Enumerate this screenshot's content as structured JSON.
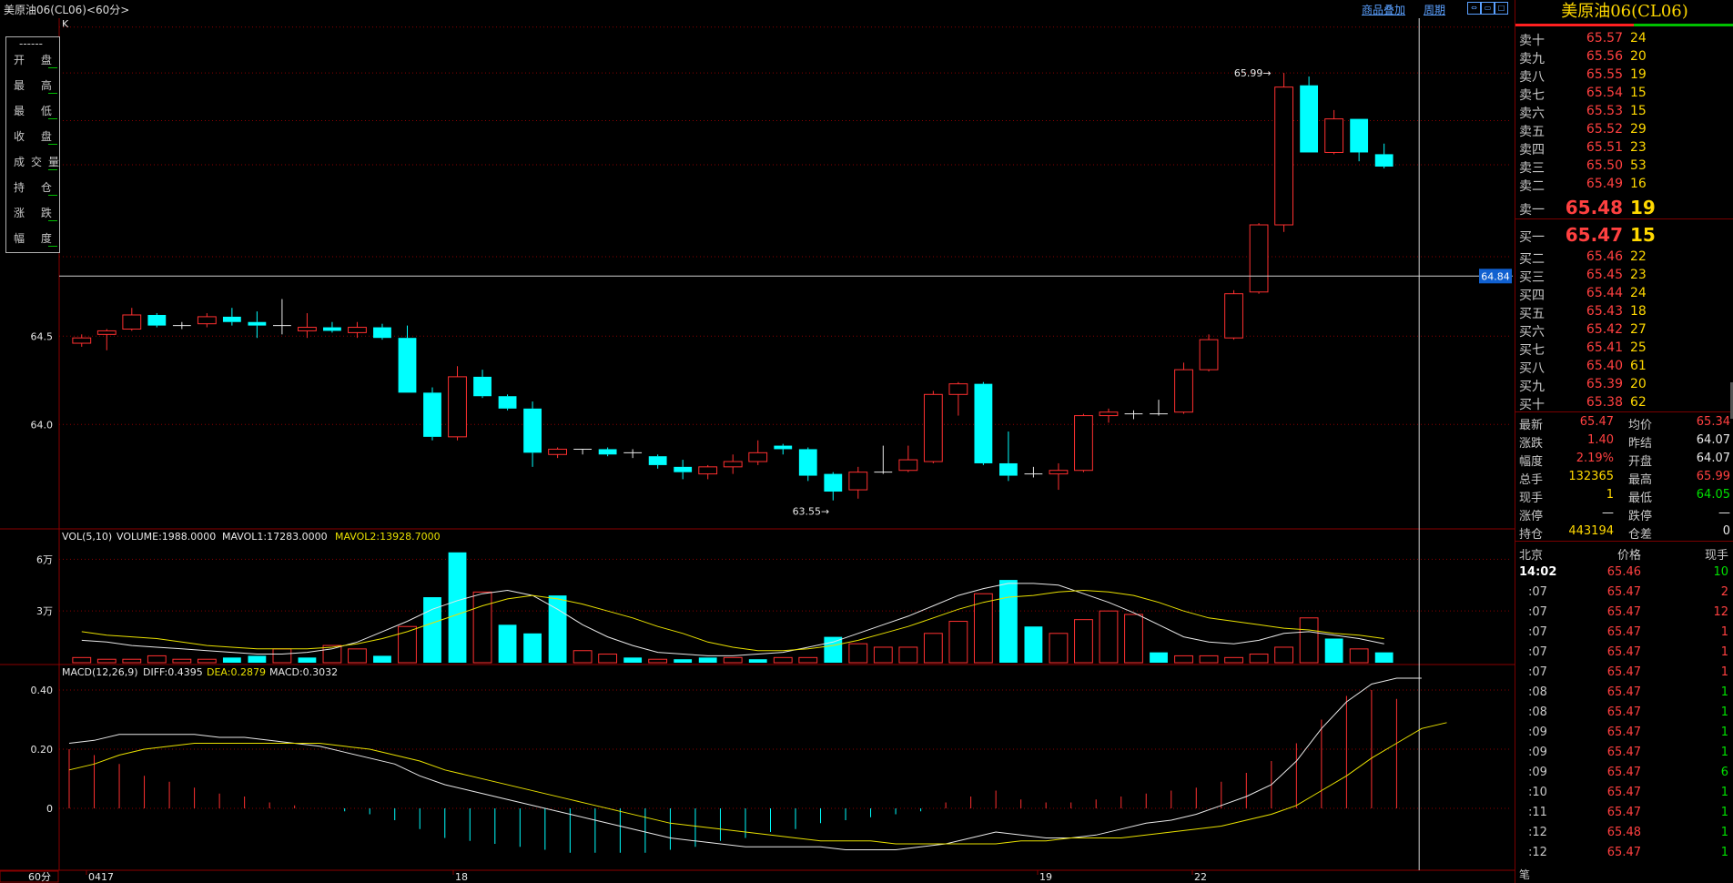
{
  "window": {
    "title": "美原油06(CL06)<60分>",
    "links": [
      "商品叠加",
      "周期"
    ],
    "window_buttons": [
      "restore-icon",
      "minimize-icon",
      "maximize-icon",
      "close-icon"
    ]
  },
  "kchart": {
    "type": "candlestick",
    "label": "K",
    "y_ticks": [
      "64.5",
      "64.0"
    ],
    "crosshair_price": "64.84",
    "high_label": "65.99→",
    "low_label": "63.55→",
    "candles": [
      [
        64.46,
        64.51,
        64.44,
        64.49
      ],
      [
        64.51,
        64.54,
        64.42,
        64.53
      ],
      [
        64.54,
        64.66,
        64.53,
        64.62
      ],
      [
        64.62,
        64.63,
        64.55,
        64.56
      ],
      [
        64.56,
        64.58,
        64.54,
        64.55
      ],
      [
        64.57,
        64.63,
        64.55,
        64.61
      ],
      [
        64.61,
        64.66,
        64.56,
        64.58
      ],
      [
        64.58,
        64.64,
        64.49,
        64.56
      ],
      [
        64.56,
        64.71,
        64.51,
        64.55
      ],
      [
        64.53,
        64.63,
        64.49,
        64.55
      ],
      [
        64.55,
        64.58,
        64.52,
        64.53
      ],
      [
        64.52,
        64.58,
        64.49,
        64.55
      ],
      [
        64.55,
        64.57,
        64.48,
        64.49
      ],
      [
        64.49,
        64.56,
        64.18,
        64.18
      ],
      [
        64.18,
        64.21,
        63.91,
        63.93
      ],
      [
        63.93,
        64.33,
        63.91,
        64.27
      ],
      [
        64.27,
        64.31,
        64.15,
        64.16
      ],
      [
        64.16,
        64.17,
        64.08,
        64.09
      ],
      [
        64.09,
        64.13,
        63.76,
        63.84
      ],
      [
        63.83,
        63.87,
        63.81,
        63.86
      ],
      [
        63.86,
        63.86,
        63.83,
        63.85
      ],
      [
        63.86,
        63.87,
        63.82,
        63.83
      ],
      [
        63.84,
        63.86,
        63.81,
        63.83
      ],
      [
        63.82,
        63.83,
        63.75,
        63.77
      ],
      [
        63.76,
        63.8,
        63.69,
        63.73
      ],
      [
        63.72,
        63.77,
        63.69,
        63.76
      ],
      [
        63.76,
        63.83,
        63.72,
        63.79
      ],
      [
        63.79,
        63.91,
        63.77,
        63.84
      ],
      [
        63.88,
        63.89,
        63.83,
        63.86
      ],
      [
        63.86,
        63.87,
        63.68,
        63.71
      ],
      [
        63.72,
        63.73,
        63.57,
        63.62
      ],
      [
        63.63,
        63.76,
        63.58,
        63.73
      ],
      [
        63.73,
        63.88,
        63.72,
        63.74
      ],
      [
        63.74,
        63.88,
        63.73,
        63.8
      ],
      [
        63.79,
        64.19,
        63.78,
        64.17
      ],
      [
        64.17,
        64.24,
        64.05,
        64.23
      ],
      [
        64.23,
        64.24,
        63.77,
        63.78
      ],
      [
        63.78,
        63.96,
        63.68,
        63.71
      ],
      [
        63.72,
        63.76,
        63.7,
        63.73
      ],
      [
        63.72,
        63.78,
        63.63,
        63.74
      ],
      [
        63.74,
        64.06,
        63.73,
        64.05
      ],
      [
        64.05,
        64.09,
        64.01,
        64.07
      ],
      [
        64.06,
        64.08,
        64.03,
        64.06
      ],
      [
        64.06,
        64.14,
        64.05,
        64.06
      ],
      [
        64.07,
        64.35,
        64.06,
        64.31
      ],
      [
        64.31,
        64.51,
        64.3,
        64.48
      ],
      [
        64.49,
        64.76,
        64.48,
        64.74
      ],
      [
        64.75,
        65.14,
        64.74,
        65.13
      ],
      [
        65.13,
        65.99,
        65.09,
        65.91
      ],
      [
        65.92,
        65.97,
        65.54,
        65.54
      ],
      [
        65.54,
        65.78,
        65.53,
        65.73
      ],
      [
        65.73,
        65.73,
        65.49,
        65.54
      ],
      [
        65.53,
        65.59,
        65.45,
        65.46
      ]
    ]
  },
  "volume": {
    "header_name": "VOL(5,10)",
    "header_volume": "VOLUME:1988.0000",
    "header_mavol1": "MAVOL1:17283.0000",
    "header_mavol2": "MAVOL2:13928.7000",
    "y_ticks": [
      "6万",
      "3万"
    ],
    "values": [
      3,
      2,
      2,
      4,
      2,
      2,
      3,
      4,
      8,
      3,
      10,
      8,
      4,
      21,
      38,
      64,
      41,
      22,
      17,
      39,
      7,
      5,
      3,
      2,
      2,
      3,
      3,
      2,
      3,
      3,
      15,
      11,
      9,
      9,
      17,
      24,
      40,
      48,
      21,
      17,
      25,
      30,
      28,
      6,
      4,
      4,
      3,
      5,
      9,
      26,
      14,
      8,
      6,
      2
    ],
    "up": [
      1,
      1,
      1,
      1,
      1,
      1,
      0,
      0,
      1,
      0,
      1,
      1,
      0,
      1,
      0,
      0,
      1,
      0,
      0,
      0,
      1,
      1,
      0,
      1,
      0,
      0,
      1,
      0,
      1,
      1,
      0,
      1,
      1,
      1,
      1,
      1,
      1,
      0,
      0,
      1,
      1,
      1,
      1,
      0,
      1,
      1,
      1,
      1,
      1,
      1,
      0,
      1,
      0,
      0
    ],
    "ma1": [
      13,
      12,
      10,
      9,
      8,
      7,
      6,
      5,
      5,
      6,
      8,
      12,
      18,
      24,
      31,
      36,
      40,
      42,
      39,
      31,
      22,
      15,
      10,
      6,
      5,
      4,
      4,
      5,
      6,
      9,
      12,
      17,
      22,
      27,
      33,
      39,
      43,
      46,
      46,
      45,
      40,
      35,
      29,
      22,
      15,
      12,
      11,
      13,
      17,
      18,
      16,
      14,
      11
    ],
    "ma2": [
      18,
      16,
      15,
      14,
      12,
      10,
      9,
      8,
      8,
      8,
      9,
      11,
      14,
      18,
      23,
      28,
      33,
      37,
      39,
      37,
      34,
      30,
      26,
      21,
      17,
      12,
      9,
      7,
      7,
      8,
      10,
      13,
      17,
      21,
      26,
      31,
      35,
      38,
      39,
      41,
      42,
      41,
      39,
      35,
      30,
      26,
      24,
      22,
      20,
      19,
      17,
      16,
      14
    ]
  },
  "macd": {
    "header_name": "MACD(12,26,9)",
    "header_diff": "DIFF:0.4395",
    "header_dea": "DEA:0.2879",
    "header_macd": "MACD:0.3032",
    "y_ticks": [
      "0.40",
      "0.20",
      "0"
    ],
    "diff": [
      0.22,
      0.23,
      0.25,
      0.25,
      0.25,
      0.25,
      0.24,
      0.24,
      0.23,
      0.22,
      0.21,
      0.19,
      0.17,
      0.15,
      0.11,
      0.08,
      0.06,
      0.04,
      0.02,
      0.0,
      -0.02,
      -0.04,
      -0.06,
      -0.08,
      -0.1,
      -0.11,
      -0.12,
      -0.13,
      -0.13,
      -0.13,
      -0.13,
      -0.14,
      -0.14,
      -0.14,
      -0.13,
      -0.12,
      -0.1,
      -0.08,
      -0.09,
      -0.1,
      -0.1,
      -0.09,
      -0.07,
      -0.05,
      -0.04,
      -0.02,
      0.01,
      0.04,
      0.08,
      0.16,
      0.27,
      0.36,
      0.42,
      0.44,
      0.44
    ],
    "dea": [
      0.13,
      0.15,
      0.18,
      0.2,
      0.21,
      0.22,
      0.22,
      0.22,
      0.22,
      0.22,
      0.22,
      0.21,
      0.2,
      0.18,
      0.16,
      0.13,
      0.11,
      0.09,
      0.07,
      0.05,
      0.03,
      0.01,
      -0.01,
      -0.03,
      -0.05,
      -0.06,
      -0.07,
      -0.08,
      -0.09,
      -0.1,
      -0.11,
      -0.11,
      -0.11,
      -0.12,
      -0.12,
      -0.12,
      -0.12,
      -0.12,
      -0.11,
      -0.11,
      -0.1,
      -0.1,
      -0.1,
      -0.09,
      -0.08,
      -0.07,
      -0.06,
      -0.04,
      -0.02,
      0.01,
      0.06,
      0.11,
      0.17,
      0.22,
      0.27,
      0.29
    ],
    "macd": [
      0.2,
      0.18,
      0.15,
      0.11,
      0.09,
      0.07,
      0.05,
      0.04,
      0.02,
      0.01,
      0.0,
      -0.01,
      -0.02,
      -0.04,
      -0.07,
      -0.1,
      -0.11,
      -0.12,
      -0.13,
      -0.14,
      -0.15,
      -0.15,
      -0.15,
      -0.15,
      -0.14,
      -0.13,
      -0.11,
      -0.1,
      -0.08,
      -0.07,
      -0.05,
      -0.04,
      -0.03,
      -0.02,
      -0.01,
      0.02,
      0.04,
      0.06,
      0.03,
      0.02,
      0.02,
      0.03,
      0.04,
      0.05,
      0.06,
      0.07,
      0.09,
      0.12,
      0.16,
      0.22,
      0.3,
      0.38,
      0.4,
      0.37,
      0.3
    ]
  },
  "xaxis": {
    "period": "60分",
    "labels": [
      "0417",
      "18",
      "19",
      "22"
    ]
  },
  "quote": {
    "title": "美原油06(CL06)",
    "sell": [
      {
        "label": "卖十",
        "price": "65.57",
        "vol": "24"
      },
      {
        "label": "卖九",
        "price": "65.56",
        "vol": "20"
      },
      {
        "label": "卖八",
        "price": "65.55",
        "vol": "19"
      },
      {
        "label": "卖七",
        "price": "65.54",
        "vol": "15"
      },
      {
        "label": "卖六",
        "price": "65.53",
        "vol": "15"
      },
      {
        "label": "卖五",
        "price": "65.52",
        "vol": "29"
      },
      {
        "label": "卖四",
        "price": "65.51",
        "vol": "23"
      },
      {
        "label": "卖三",
        "price": "65.50",
        "vol": "53"
      },
      {
        "label": "卖二",
        "price": "65.49",
        "vol": "16"
      },
      {
        "label": "卖一",
        "price": "65.48",
        "vol": "19"
      }
    ],
    "buy": [
      {
        "label": "买一",
        "price": "65.47",
        "vol": "15"
      },
      {
        "label": "买二",
        "price": "65.46",
        "vol": "22"
      },
      {
        "label": "买三",
        "price": "65.45",
        "vol": "23"
      },
      {
        "label": "买四",
        "price": "65.44",
        "vol": "24"
      },
      {
        "label": "买五",
        "price": "65.43",
        "vol": "18"
      },
      {
        "label": "买六",
        "price": "65.42",
        "vol": "27"
      },
      {
        "label": "买七",
        "price": "65.41",
        "vol": "25"
      },
      {
        "label": "买八",
        "price": "65.40",
        "vol": "61"
      },
      {
        "label": "买九",
        "price": "65.39",
        "vol": "20"
      },
      {
        "label": "买十",
        "price": "65.38",
        "vol": "62"
      }
    ],
    "stats": [
      {
        "l1": "最新",
        "v1": "65.47",
        "c1": "#ff4040",
        "l2": "均价",
        "v2": "65.34",
        "c2": "#ff4040"
      },
      {
        "l1": "涨跌",
        "v1": "1.40",
        "c1": "#ff4040",
        "l2": "昨结",
        "v2": "64.07",
        "c2": "#e8e8e8"
      },
      {
        "l1": "幅度",
        "v1": "2.19%",
        "c1": "#ff4040",
        "l2": "开盘",
        "v2": "64.07",
        "c2": "#e8e8e8"
      },
      {
        "l1": "总手",
        "v1": "132365",
        "c1": "#ffd800",
        "l2": "最高",
        "v2": "65.99",
        "c2": "#ff4040"
      },
      {
        "l1": "现手",
        "v1": "1",
        "c1": "#ffd800",
        "l2": "最低",
        "v2": "64.05",
        "c2": "#00e000"
      },
      {
        "l1": "涨停",
        "v1": "—",
        "c1": "#e8e8e8",
        "l2": "跌停",
        "v2": "—",
        "c2": "#e8e8e8"
      },
      {
        "l1": "持仓",
        "v1": "443194",
        "c1": "#ffd800",
        "l2": "仓差",
        "v2": "0",
        "c2": "#e8e8e8"
      }
    ],
    "ticks_header": {
      "time": "北京",
      "price": "价格",
      "vol": "现手"
    },
    "ticks": [
      {
        "time": "14:02",
        "price": "65.46",
        "vol": "10",
        "vc": "#00e000"
      },
      {
        "time": ":07",
        "price": "65.47",
        "vol": "2",
        "vc": "#ff4040"
      },
      {
        "time": ":07",
        "price": "65.47",
        "vol": "12",
        "vc": "#ff4040"
      },
      {
        "time": ":07",
        "price": "65.47",
        "vol": "1",
        "vc": "#ff4040"
      },
      {
        "time": ":07",
        "price": "65.47",
        "vol": "1",
        "vc": "#ff4040"
      },
      {
        "time": ":07",
        "price": "65.47",
        "vol": "1",
        "vc": "#ff4040"
      },
      {
        "time": ":08",
        "price": "65.47",
        "vol": "1",
        "vc": "#00e000"
      },
      {
        "time": ":08",
        "price": "65.47",
        "vol": "1",
        "vc": "#00e000"
      },
      {
        "time": ":09",
        "price": "65.47",
        "vol": "1",
        "vc": "#00e000"
      },
      {
        "time": ":09",
        "price": "65.47",
        "vol": "1",
        "vc": "#00e000"
      },
      {
        "time": ":09",
        "price": "65.47",
        "vol": "6",
        "vc": "#00e000"
      },
      {
        "time": ":10",
        "price": "65.47",
        "vol": "1",
        "vc": "#00e000"
      },
      {
        "time": ":11",
        "price": "65.47",
        "vol": "1",
        "vc": "#00e000"
      },
      {
        "time": ":12",
        "price": "65.48",
        "vol": "1",
        "vc": "#00e000"
      },
      {
        "time": ":12",
        "price": "65.47",
        "vol": "1",
        "vc": "#00e000"
      }
    ],
    "footer_tab": "笔"
  },
  "infobox": [
    "------",
    "开 盘",
    "最 高",
    "最 低",
    "收 盘",
    "成交量",
    "持 仓",
    "涨 跌",
    "幅 度"
  ],
  "colors": {
    "up": "#ff3030",
    "down": "#00ffff",
    "white": "#e8e8e8",
    "yellow": "#e8e000",
    "grid": "#8a0000"
  }
}
